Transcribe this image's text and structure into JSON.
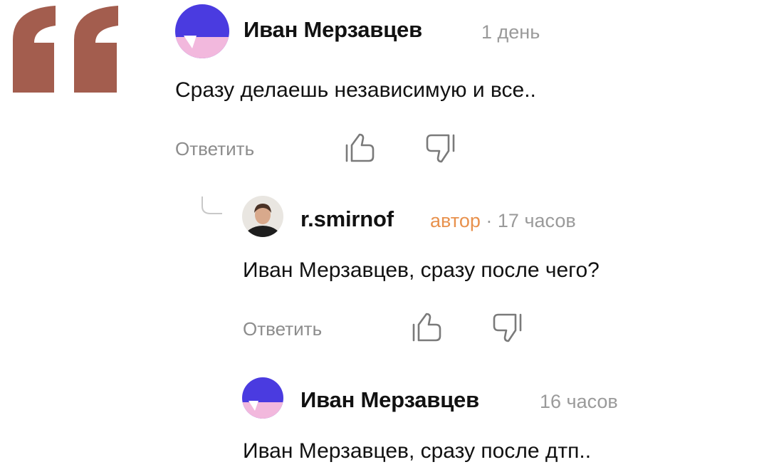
{
  "comments": [
    {
      "author": "Иван Мерзавцев",
      "time": "1 день",
      "text": "Сразу делаешь независимую и все..",
      "reply_label": "Ответить",
      "like_icon": "thumbs-up-icon",
      "dislike_icon": "thumbs-down-icon"
    },
    {
      "author": "r.smirnof",
      "badge": "автор",
      "separator": "·",
      "time": "17 часов",
      "text": "Иван Мерзавцев, сразу после чего?",
      "reply_label": "Ответить",
      "like_icon": "thumbs-up-icon",
      "dislike_icon": "thumbs-down-icon"
    },
    {
      "author": "Иван Мерзавцев",
      "time": "16 часов",
      "text": "Иван Мерзавцев, сразу после дтп.."
    }
  ],
  "colors": {
    "quote_mark": "#a35d4e",
    "author_badge": "#e8914d",
    "avatar_blue": "#4a3be0",
    "avatar_pink": "#f2b8dd"
  }
}
